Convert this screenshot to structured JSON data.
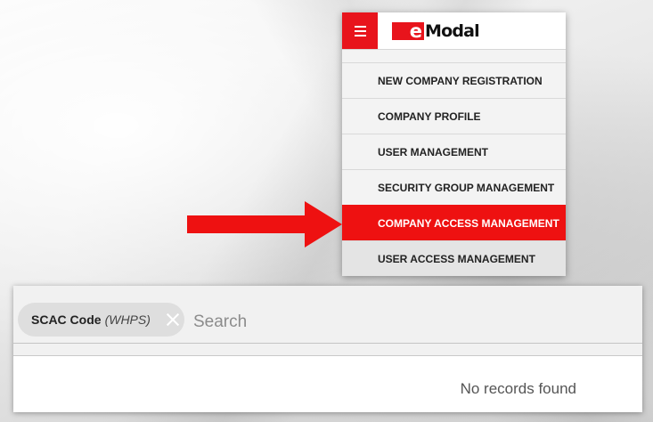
{
  "top_text": "                                                                                   ",
  "menu": {
    "logo_letter": "e",
    "logo_text": "Modal",
    "items": [
      {
        "label": "NEW COMPANY REGISTRATION",
        "active": false
      },
      {
        "label": "COMPANY PROFILE",
        "active": false
      },
      {
        "label": "USER MANAGEMENT",
        "active": false
      },
      {
        "label": "SECURITY GROUP MANAGEMENT",
        "active": false
      },
      {
        "label": "COMPANY ACCESS MANAGEMENT",
        "active": true
      },
      {
        "label": "USER ACCESS MANAGEMENT",
        "active": false
      }
    ]
  },
  "search": {
    "chip_label": "SCAC Code",
    "chip_value": "(WHPS)",
    "placeholder": "Search",
    "value": ""
  },
  "results": {
    "empty_message": "No records found"
  },
  "colors": {
    "brand_red": "#e8141c",
    "active_item": "#ee1111",
    "arrow": "#ee1111"
  },
  "icons": {
    "menu": "hamburger-icon",
    "chip_close": "close-icon",
    "pointer": "right-arrow-icon"
  }
}
